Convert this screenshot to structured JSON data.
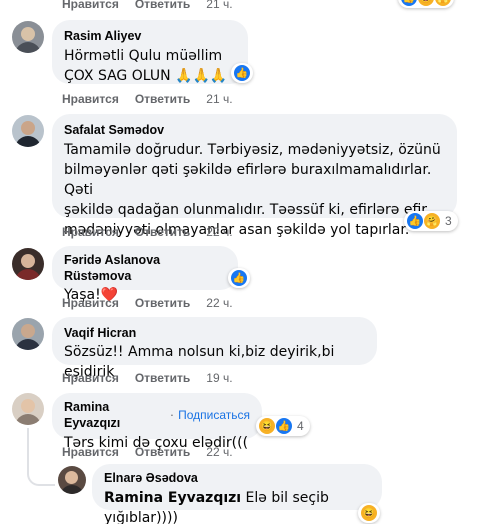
{
  "top_actions": {
    "like": "Нравится",
    "reply": "Ответить",
    "time": "21 ч."
  },
  "comments": [
    {
      "author": "Rasim Aliyev",
      "text_lines": [
        "Hörmətli Qulu müəllim",
        "ÇOX SAG OLUN 🙏🙏🙏"
      ],
      "actions": {
        "like": "Нравится",
        "reply": "Ответить",
        "time": "21 ч."
      },
      "reactions": {
        "icons": [
          "like"
        ],
        "count": ""
      }
    },
    {
      "author": "Safalat Səmədov",
      "text_lines": [
        "Tamamilə doğrudur. Tərbiyəsiz, mədəniyyətsiz, özünü",
        "bilməyənlər qəti şəkildə efirlərə buraxılmamalıdırlar. Qəti",
        "şəkildə qadağan olunmalıdır. Təəssüf ki, efirlərə efir",
        "mədəniyyəti olmayanlar asan şəkildə yol tapırlar."
      ],
      "actions": {
        "like": "Нравится",
        "reply": "Ответить",
        "time": "22 ч."
      },
      "reactions": {
        "icons": [
          "like",
          "care"
        ],
        "count": "3"
      }
    },
    {
      "author": "Fəridə Aslanova Rüstəmova",
      "text_lines": [
        "Yaşa!❤️"
      ],
      "actions": {
        "like": "Нравится",
        "reply": "Ответить",
        "time": "22 ч."
      },
      "reactions": {
        "icons": [
          "like"
        ],
        "count": ""
      }
    },
    {
      "author": "Vaqif Hicran",
      "text_lines": [
        "Sözsüz!! Amma nolsun ki,biz deyirik,bi eşidirik"
      ],
      "actions": {
        "like": "Нравится",
        "reply": "Ответить",
        "time": "19 ч."
      },
      "reactions": {
        "icons": [],
        "count": ""
      }
    },
    {
      "author": "Ramina Eyvazqızı",
      "follow": "Подписаться",
      "text_lines": [
        "Tərs kimi də çoxu elədir((("
      ],
      "actions": {
        "like": "Нравится",
        "reply": "Ответить",
        "time": "22 ч."
      },
      "reactions": {
        "icons": [
          "haha",
          "like"
        ],
        "count": "4"
      }
    }
  ],
  "reply": {
    "author": "Elnarə Əsədova",
    "mention": "Ramina Eyvazqızı",
    "text": "Elə bil seçib yığıblar))))",
    "reactions": {
      "icons": [
        "haha"
      ],
      "count": ""
    }
  },
  "colors": {
    "bubble": "#f0f2f5",
    "meta": "#65676b",
    "link": "#1b74e4",
    "like": "#1877f2"
  }
}
